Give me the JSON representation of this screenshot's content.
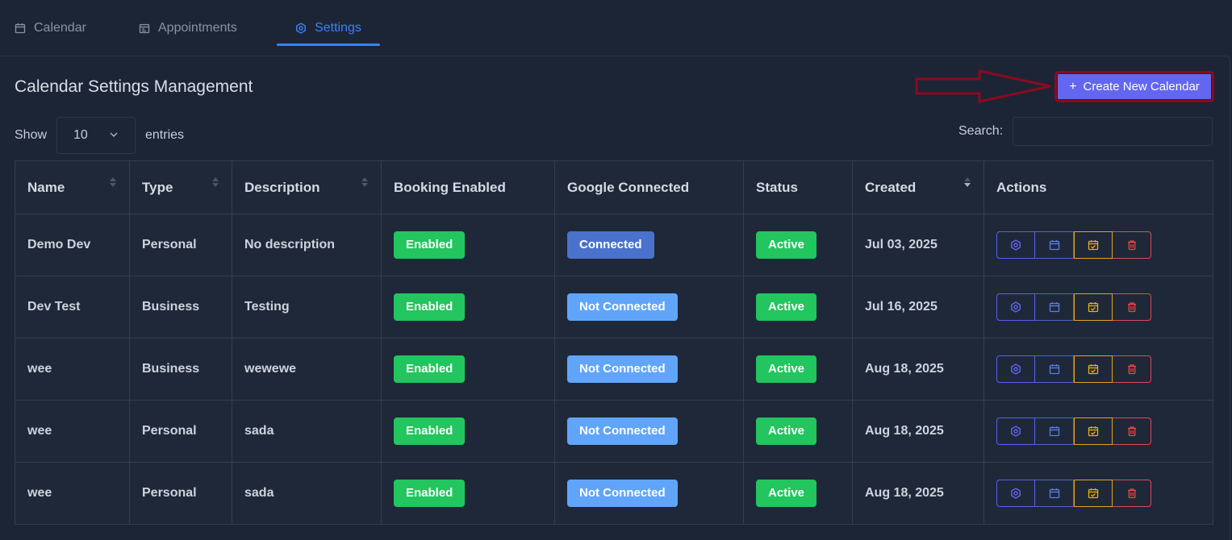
{
  "tabs": [
    {
      "label": "Calendar",
      "icon": "calendar-icon",
      "active": false
    },
    {
      "label": "Appointments",
      "icon": "appointments-icon",
      "active": false
    },
    {
      "label": "Settings",
      "icon": "settings-icon",
      "active": true
    }
  ],
  "page": {
    "title": "Calendar Settings Management",
    "create_button": "Create New Calendar",
    "create_button_icon": "plus-icon"
  },
  "controls": {
    "show_label": "Show",
    "entries_value": "10",
    "entries_label": "entries",
    "search_label": "Search:",
    "search_value": ""
  },
  "table": {
    "headers": [
      "Name",
      "Type",
      "Description",
      "Booking Enabled",
      "Google Connected",
      "Status",
      "Created",
      "Actions"
    ],
    "rows": [
      {
        "name": "Demo Dev",
        "type": "Personal",
        "description": "No description",
        "booking": "Enabled",
        "google": "Connected",
        "status": "Active",
        "created": "Jul 03, 2025"
      },
      {
        "name": "Dev Test",
        "type": "Business",
        "description": "Testing",
        "booking": "Enabled",
        "google": "Not Connected",
        "status": "Active",
        "created": "Jul 16, 2025"
      },
      {
        "name": "wee",
        "type": "Business",
        "description": "wewewe",
        "booking": "Enabled",
        "google": "Not Connected",
        "status": "Active",
        "created": "Aug 18, 2025"
      },
      {
        "name": "wee",
        "type": "Personal",
        "description": "sada",
        "booking": "Enabled",
        "google": "Not Connected",
        "status": "Active",
        "created": "Aug 18, 2025"
      },
      {
        "name": "wee",
        "type": "Personal",
        "description": "sada",
        "booking": "Enabled",
        "google": "Not Connected",
        "status": "Active",
        "created": "Aug 18, 2025"
      }
    ],
    "action_icons": [
      "settings-icon",
      "calendar-icon",
      "calendar-check-icon",
      "trash-icon"
    ]
  },
  "colors": {
    "accent": "#3b82f6",
    "create_button": "#6366f1",
    "annotation": "#8b0a1f",
    "enabled": "#22c55e",
    "connected": "#4a72cc",
    "not_connected": "#60a5fa",
    "delete": "#e0485a",
    "schedule": "#e0a31a"
  }
}
